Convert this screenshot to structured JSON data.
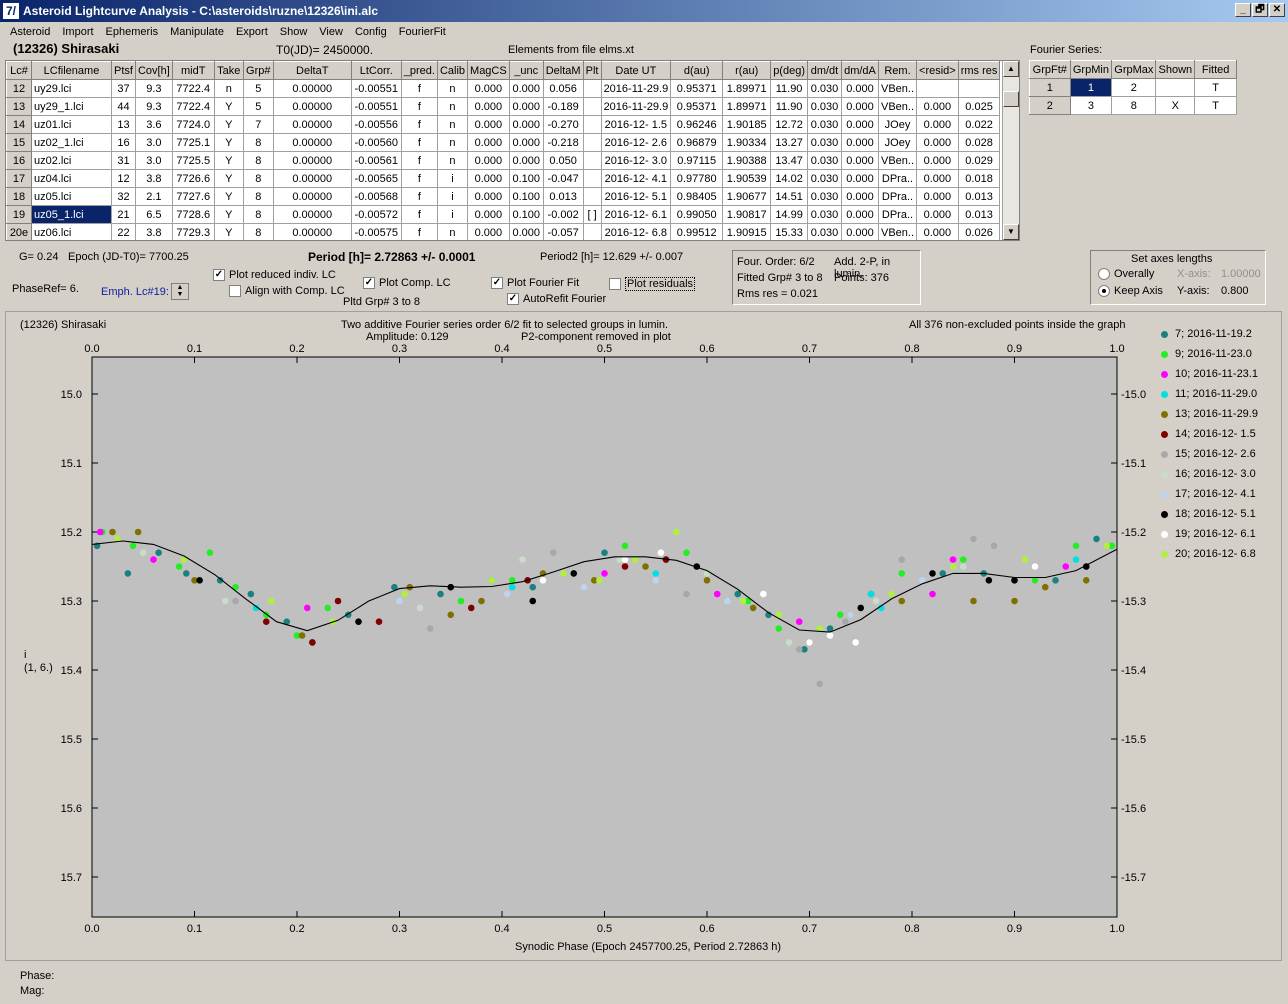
{
  "window": {
    "title": "Asteroid Lightcurve Analysis - C:\\asteroids\\ruzne\\12326\\ini.alc",
    "icon_text": "7/",
    "buttons": [
      "_",
      "🗗",
      "✕"
    ]
  },
  "menu": [
    "Asteroid",
    "Import",
    "Ephemeris",
    "Manipulate",
    "Export",
    "Show",
    "View",
    "Config",
    "FourierFit"
  ],
  "header": {
    "object_name": "(12326) Shirasaki",
    "t0": "T0(JD)= 2450000.",
    "elements": "Elements from file elms.xt"
  },
  "lc_table": {
    "columns": [
      "Lc#",
      "LCfilename",
      "Ptsf",
      "Cov[h]",
      "midT",
      "Take",
      "Grp#",
      "DeltaT",
      "LtCorr.",
      "_pred.",
      "Calib",
      "MagCS",
      "_unc",
      "DeltaM",
      "Plt",
      "Date UT",
      "d(au)",
      "r(au)",
      "p(deg)",
      "dm/dt",
      "dm/dA",
      "Rem.",
      "<resid>",
      "rms res"
    ],
    "rows": [
      [
        "12",
        "uy29.lci",
        "37",
        "9.3",
        "7722.4",
        "n",
        "5",
        "0.00000",
        "-0.00551",
        "f",
        "n",
        "0.000",
        "0.000",
        "0.056",
        "",
        "2016-11-29.9",
        "0.95371",
        "1.89971",
        "11.90",
        "0.030",
        "0.000",
        "VBen..",
        "",
        ""
      ],
      [
        "13",
        "uy29_1.lci",
        "44",
        "9.3",
        "7722.4",
        "Y",
        "5",
        "0.00000",
        "-0.00551",
        "f",
        "n",
        "0.000",
        "0.000",
        "-0.189",
        "",
        "2016-11-29.9",
        "0.95371",
        "1.89971",
        "11.90",
        "0.030",
        "0.000",
        "VBen..",
        "0.000",
        "0.025"
      ],
      [
        "14",
        "uz01.lci",
        "13",
        "3.6",
        "7724.0",
        "Y",
        "7",
        "0.00000",
        "-0.00556",
        "f",
        "n",
        "0.000",
        "0.000",
        "-0.270",
        "",
        "2016-12- 1.5",
        "0.96246",
        "1.90185",
        "12.72",
        "0.030",
        "0.000",
        "JOey",
        "0.000",
        "0.022"
      ],
      [
        "15",
        "uz02_1.lci",
        "16",
        "3.0",
        "7725.1",
        "Y",
        "8",
        "0.00000",
        "-0.00560",
        "f",
        "n",
        "0.000",
        "0.000",
        "-0.218",
        "",
        "2016-12- 2.6",
        "0.96879",
        "1.90334",
        "13.27",
        "0.030",
        "0.000",
        "JOey",
        "0.000",
        "0.028"
      ],
      [
        "16",
        "uz02.lci",
        "31",
        "3.0",
        "7725.5",
        "Y",
        "8",
        "0.00000",
        "-0.00561",
        "f",
        "n",
        "0.000",
        "0.000",
        "0.050",
        "",
        "2016-12- 3.0",
        "0.97115",
        "1.90388",
        "13.47",
        "0.030",
        "0.000",
        "VBen..",
        "0.000",
        "0.029"
      ],
      [
        "17",
        "uz04.lci",
        "12",
        "3.8",
        "7726.6",
        "Y",
        "8",
        "0.00000",
        "-0.00565",
        "f",
        "i",
        "0.000",
        "0.100",
        "-0.047",
        "",
        "2016-12- 4.1",
        "0.97780",
        "1.90539",
        "14.02",
        "0.030",
        "0.000",
        "DPra..",
        "0.000",
        "0.018"
      ],
      [
        "18",
        "uz05.lci",
        "32",
        "2.1",
        "7727.6",
        "Y",
        "8",
        "0.00000",
        "-0.00568",
        "f",
        "i",
        "0.000",
        "0.100",
        "0.013",
        "",
        "2016-12- 5.1",
        "0.98405",
        "1.90677",
        "14.51",
        "0.030",
        "0.000",
        "DPra..",
        "0.000",
        "0.013"
      ],
      [
        "19",
        "uz05_1.lci",
        "21",
        "6.5",
        "7728.6",
        "Y",
        "8",
        "0.00000",
        "-0.00572",
        "f",
        "i",
        "0.000",
        "0.100",
        "-0.002",
        "[ ]",
        "2016-12- 6.1",
        "0.99050",
        "1.90817",
        "14.99",
        "0.030",
        "0.000",
        "DPra..",
        "0.000",
        "0.013"
      ],
      [
        "20e",
        "uz06.lci",
        "22",
        "3.8",
        "7729.3",
        "Y",
        "8",
        "0.00000",
        "-0.00575",
        "f",
        "n",
        "0.000",
        "0.000",
        "-0.057",
        "",
        "2016-12- 6.8",
        "0.99512",
        "1.90915",
        "15.33",
        "0.030",
        "0.000",
        "VBen..",
        "0.000",
        "0.026"
      ]
    ],
    "selected_row": 7
  },
  "fourier_series": {
    "title": "Fourier Series:",
    "columns": [
      "GrpFt#",
      "GrpMin",
      "GrpMax",
      "Shown",
      "Fitted"
    ],
    "rows": [
      [
        "1",
        "1",
        "2",
        "",
        "T"
      ],
      [
        "2",
        "3",
        "8",
        "X",
        "T"
      ]
    ]
  },
  "params": {
    "g": "G= 0.24",
    "epoch": "Epoch (JD-T0)= 7700.25",
    "period": "Period [h]= 2.72863 +/- 0.0001",
    "period2": "Period2 [h]= 12.629 +/- 0.007",
    "phase_ref": "PhaseRef= 6.",
    "emph": "Emph. Lc#19:",
    "pltd_grp": "Pltd Grp#  3   to   8"
  },
  "checkboxes": {
    "plot_reduced": {
      "label": "Plot reduced indiv. LC",
      "checked": "✓"
    },
    "align_comp": {
      "label": "Align with Comp. LC",
      "checked": ""
    },
    "plot_comp": {
      "label": "Plot Comp. LC",
      "checked": "✓"
    },
    "plot_fourier": {
      "label": "Plot Fourier Fit",
      "checked": "✓"
    },
    "autorefit": {
      "label": "AutoRefit Fourier",
      "checked": "✓"
    },
    "plot_residuals": {
      "label": "Plot residuals",
      "checked": ""
    }
  },
  "fit_info": {
    "four_order": "Four. Order:  6/2",
    "add": "Add. 2-P, in lumin.",
    "fitted_grp": "Fitted Grp# 3 to 8",
    "points": "Points: 376",
    "rms": "Rms res      = 0.021"
  },
  "axes_box": {
    "title": "Set axes lengths",
    "overally": "Overally",
    "keep_axis": "Keep Axis",
    "x_label": "X-axis:",
    "x_value": "1.00000",
    "y_label": "Y-axis:",
    "y_value": "0.800"
  },
  "plot": {
    "object": "(12326) Shirasaki",
    "desc1": "Two additive Fourier series order 6/2 fit to selected groups in lumin.",
    "desc2": "Amplitude: 0.129",
    "desc3": "P2-component removed in plot",
    "right_note": "All 376 non-excluded points inside the graph",
    "ylabel1": "i",
    "ylabel2": "(1, 6.)",
    "xlabel": "Synodic Phase (Epoch 2457700.25, Period 2.72863 h)"
  },
  "status": {
    "phase": "Phase:",
    "mag": "Mag:"
  },
  "chart_data": {
    "type": "scatter",
    "title": "Two additive Fourier series order 6/2 fit to selected groups in lumin.",
    "xlabel": "Synodic Phase (Epoch 2457700.25, Period 2.72863 h)",
    "ylabel": "i (1, 6.)",
    "xlim": [
      0.0,
      1.0
    ],
    "ylim": [
      15.75,
      14.95
    ],
    "y_inverted": true,
    "x_ticks": [
      "0.0",
      "0.1",
      "0.2",
      "0.3",
      "0.4",
      "0.5",
      "0.6",
      "0.7",
      "0.8",
      "0.9",
      "1.0"
    ],
    "y_ticks": [
      "15.0",
      "15.1",
      "15.2",
      "15.3",
      "15.4",
      "15.5",
      "15.6",
      "15.7"
    ],
    "grid": false,
    "legend_position": "right",
    "fit_curve": {
      "x": [
        0.0,
        0.03,
        0.06,
        0.09,
        0.12,
        0.15,
        0.18,
        0.21,
        0.24,
        0.27,
        0.3,
        0.33,
        0.36,
        0.39,
        0.42,
        0.45,
        0.48,
        0.51,
        0.54,
        0.57,
        0.6,
        0.63,
        0.66,
        0.69,
        0.72,
        0.75,
        0.78,
        0.81,
        0.84,
        0.87,
        0.9,
        0.93,
        0.96,
        1.0
      ],
      "y": [
        15.218,
        15.213,
        15.218,
        15.235,
        15.262,
        15.297,
        15.33,
        15.343,
        15.328,
        15.3,
        15.282,
        15.278,
        15.28,
        15.279,
        15.272,
        15.258,
        15.243,
        15.236,
        15.236,
        15.241,
        15.256,
        15.283,
        15.317,
        15.342,
        15.345,
        15.327,
        15.297,
        15.275,
        15.26,
        15.26,
        15.266,
        15.266,
        15.256,
        15.225
      ]
    },
    "series": [
      {
        "name": "7; 2016-11-19.2",
        "color": "#1a8080",
        "x": [
          0.005,
          0.035,
          0.065,
          0.092,
          0.125,
          0.155,
          0.19,
          0.215,
          0.25,
          0.295,
          0.34,
          0.39,
          0.43,
          0.5,
          0.56,
          0.63,
          0.66,
          0.695,
          0.72,
          0.76,
          0.83,
          0.87,
          0.9,
          0.94,
          0.98
        ],
        "y": [
          15.22,
          15.26,
          15.23,
          15.26,
          15.27,
          15.29,
          15.33,
          15.36,
          15.32,
          15.28,
          15.29,
          15.27,
          15.28,
          15.23,
          15.24,
          15.29,
          15.32,
          15.37,
          15.34,
          15.29,
          15.26,
          15.26,
          15.27,
          15.27,
          15.21
        ]
      },
      {
        "name": "9; 2016-11-23.0",
        "color": "#22ee22",
        "x": [
          0.01,
          0.04,
          0.085,
          0.115,
          0.14,
          0.17,
          0.2,
          0.23,
          0.26,
          0.36,
          0.41,
          0.47,
          0.52,
          0.58,
          0.64,
          0.67,
          0.73,
          0.79,
          0.85,
          0.92,
          0.96,
          0.995
        ],
        "y": [
          15.2,
          15.22,
          15.25,
          15.23,
          15.28,
          15.32,
          15.35,
          15.31,
          15.33,
          15.3,
          15.27,
          15.26,
          15.22,
          15.23,
          15.3,
          15.34,
          15.32,
          15.26,
          15.24,
          15.27,
          15.22,
          15.22
        ]
      },
      {
        "name": "10; 2016-11-23.1",
        "color": "#ff00ff",
        "x": [
          0.008,
          0.06,
          0.21,
          0.5,
          0.61,
          0.69,
          0.82,
          0.84,
          0.95
        ],
        "y": [
          15.2,
          15.24,
          15.31,
          15.26,
          15.29,
          15.33,
          15.29,
          15.24,
          15.25
        ]
      },
      {
        "name": "11; 2016-11-29.0",
        "color": "#00e0e0",
        "x": [
          0.16,
          0.41,
          0.55,
          0.76,
          0.77,
          0.96
        ],
        "y": [
          15.31,
          15.28,
          15.26,
          15.29,
          15.31,
          15.24
        ]
      },
      {
        "name": "13; 2016-11-29.9",
        "color": "#807000",
        "x": [
          0.02,
          0.045,
          0.1,
          0.205,
          0.31,
          0.35,
          0.38,
          0.44,
          0.49,
          0.54,
          0.6,
          0.645,
          0.7,
          0.74,
          0.79,
          0.86,
          0.9,
          0.93,
          0.97
        ],
        "y": [
          15.2,
          15.2,
          15.27,
          15.35,
          15.28,
          15.32,
          15.3,
          15.26,
          15.27,
          15.25,
          15.27,
          15.31,
          15.36,
          15.32,
          15.3,
          15.3,
          15.3,
          15.28,
          15.27
        ]
      },
      {
        "name": "14; 2016-12- 1.5",
        "color": "#800000",
        "x": [
          0.17,
          0.215,
          0.24,
          0.28,
          0.37,
          0.425,
          0.52,
          0.56
        ],
        "y": [
          15.33,
          15.36,
          15.3,
          15.33,
          15.31,
          15.27,
          15.25,
          15.24
        ]
      },
      {
        "name": "15; 2016-12- 2.6",
        "color": "#a8a8a8",
        "x": [
          0.14,
          0.33,
          0.45,
          0.58,
          0.69,
          0.71,
          0.735,
          0.79,
          0.86,
          0.88
        ],
        "y": [
          15.3,
          15.34,
          15.23,
          15.29,
          15.37,
          15.42,
          15.33,
          15.24,
          15.21,
          15.22
        ]
      },
      {
        "name": "16; 2016-12- 3.0",
        "color": "#c8dcc8",
        "x": [
          0.05,
          0.13,
          0.32,
          0.42,
          0.515,
          0.6,
          0.68,
          0.765,
          0.85
        ],
        "y": [
          15.23,
          15.3,
          15.31,
          15.24,
          15.24,
          15.26,
          15.36,
          15.3,
          15.25
        ]
      },
      {
        "name": "17; 2016-12- 4.1",
        "color": "#bcd4f0",
        "x": [
          0.3,
          0.405,
          0.48,
          0.55,
          0.62,
          0.74,
          0.81
        ],
        "y": [
          15.3,
          15.29,
          15.28,
          15.27,
          15.3,
          15.32,
          15.27
        ]
      },
      {
        "name": "18; 2016-12- 5.1",
        "color": "#000000",
        "x": [
          0.105,
          0.26,
          0.35,
          0.43,
          0.47,
          0.59,
          0.75,
          0.82,
          0.875,
          0.9,
          0.97
        ],
        "y": [
          15.27,
          15.33,
          15.28,
          15.3,
          15.26,
          15.25,
          15.31,
          15.26,
          15.27,
          15.27,
          15.25
        ]
      },
      {
        "name": "19; 2016-12- 6.1",
        "color": "#ffffff",
        "x": [
          0.44,
          0.52,
          0.555,
          0.655,
          0.7,
          0.72,
          0.745,
          0.92
        ],
        "y": [
          15.27,
          15.24,
          15.23,
          15.29,
          15.36,
          15.35,
          15.36,
          15.25
        ]
      },
      {
        "name": "20; 2016-12- 6.8",
        "color": "#b0ee40",
        "x": [
          0.025,
          0.09,
          0.175,
          0.235,
          0.305,
          0.39,
          0.46,
          0.495,
          0.53,
          0.57,
          0.635,
          0.67,
          0.71,
          0.78,
          0.84,
          0.91,
          0.99
        ],
        "y": [
          15.21,
          15.24,
          15.3,
          15.33,
          15.29,
          15.27,
          15.26,
          15.27,
          15.24,
          15.2,
          15.3,
          15.32,
          15.34,
          15.29,
          15.25,
          15.24,
          15.22
        ]
      }
    ]
  }
}
